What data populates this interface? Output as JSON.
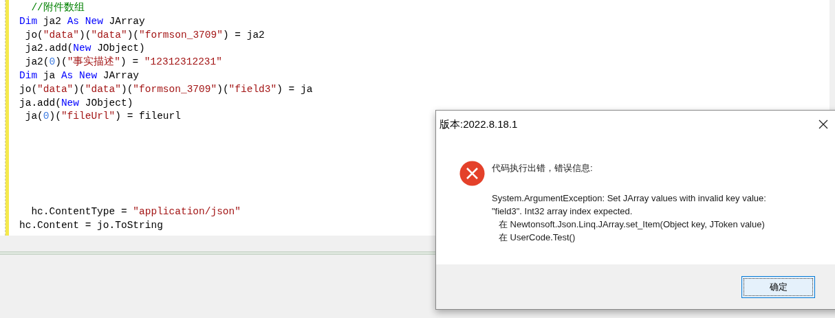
{
  "editor": {
    "lines": [
      {
        "kind": "code",
        "tokens": [
          {
            "kind": "comment",
            "text": "  //附件数组"
          }
        ]
      },
      {
        "kind": "code",
        "tokens": [
          {
            "kind": "keyword",
            "text": "Dim"
          },
          {
            "kind": "plain",
            "text": " ja2 "
          },
          {
            "kind": "keyword",
            "text": "As"
          },
          {
            "kind": "keyword",
            "text": " New"
          },
          {
            "kind": "plain",
            "text": " JArray"
          }
        ]
      },
      {
        "kind": "code",
        "tokens": [
          {
            "kind": "plain",
            "text": " jo("
          },
          {
            "kind": "string",
            "text": "\"data\""
          },
          {
            "kind": "plain",
            "text": ")("
          },
          {
            "kind": "string",
            "text": "\"data\""
          },
          {
            "kind": "plain",
            "text": ")("
          },
          {
            "kind": "string",
            "text": "\"formson_3709\""
          },
          {
            "kind": "plain",
            "text": ") = ja2"
          }
        ]
      },
      {
        "kind": "code",
        "tokens": [
          {
            "kind": "plain",
            "text": " ja2.add("
          },
          {
            "kind": "keyword",
            "text": "New"
          },
          {
            "kind": "plain",
            "text": " JObject)"
          }
        ]
      },
      {
        "kind": "code",
        "tokens": [
          {
            "kind": "plain",
            "text": " ja2("
          },
          {
            "kind": "number",
            "text": "0"
          },
          {
            "kind": "plain",
            "text": ")("
          },
          {
            "kind": "string",
            "text": "\"事实描述\""
          },
          {
            "kind": "plain",
            "text": ") = "
          },
          {
            "kind": "string",
            "text": "\"12312312231\""
          }
        ]
      },
      {
        "kind": "code",
        "tokens": [
          {
            "kind": "keyword",
            "text": "Dim"
          },
          {
            "kind": "plain",
            "text": " ja "
          },
          {
            "kind": "keyword",
            "text": "As"
          },
          {
            "kind": "keyword",
            "text": " New"
          },
          {
            "kind": "plain",
            "text": " JArray"
          }
        ]
      },
      {
        "kind": "code",
        "tokens": [
          {
            "kind": "plain",
            "text": "jo("
          },
          {
            "kind": "string",
            "text": "\"data\""
          },
          {
            "kind": "plain",
            "text": ")("
          },
          {
            "kind": "string",
            "text": "\"data\""
          },
          {
            "kind": "plain",
            "text": ")("
          },
          {
            "kind": "string",
            "text": "\"formson_3709\""
          },
          {
            "kind": "plain",
            "text": ")("
          },
          {
            "kind": "string",
            "text": "\"field3\""
          },
          {
            "kind": "plain",
            "text": ") = ja"
          }
        ]
      },
      {
        "kind": "code",
        "tokens": [
          {
            "kind": "plain",
            "text": "ja.add("
          },
          {
            "kind": "keyword",
            "text": "New"
          },
          {
            "kind": "plain",
            "text": " JObject)"
          }
        ]
      },
      {
        "kind": "code",
        "tokens": [
          {
            "kind": "plain",
            "text": " ja("
          },
          {
            "kind": "number",
            "text": "0"
          },
          {
            "kind": "plain",
            "text": ")("
          },
          {
            "kind": "string",
            "text": "\"fileUrl\""
          },
          {
            "kind": "plain",
            "text": ") = fileurl"
          }
        ]
      },
      {
        "kind": "blank"
      },
      {
        "kind": "blank"
      },
      {
        "kind": "blank"
      },
      {
        "kind": "blank"
      },
      {
        "kind": "blank"
      },
      {
        "kind": "blank"
      },
      {
        "kind": "code",
        "tokens": [
          {
            "kind": "plain",
            "text": "  hc.ContentType = "
          },
          {
            "kind": "string",
            "text": "\"application/json\""
          }
        ]
      },
      {
        "kind": "code",
        "tokens": [
          {
            "kind": "plain",
            "text": "hc.Content = jo.ToString"
          }
        ]
      }
    ]
  },
  "dialog": {
    "title": "版本:2022.8.18.1",
    "heading": "代码执行出错，错误信息:",
    "message": [
      {
        "kind": "text",
        "text": "System.ArgumentException: Set JArray values with invalid key value:"
      },
      {
        "kind": "text",
        "text": "\"field3\". Int32 array index expected."
      },
      {
        "kind": "stack",
        "text": "在 Newtonsoft.Json.Linq.JArray.set_Item(Object key, JToken value)"
      },
      {
        "kind": "stack",
        "text": "在 UserCode.Test()"
      }
    ],
    "button": "确定"
  }
}
